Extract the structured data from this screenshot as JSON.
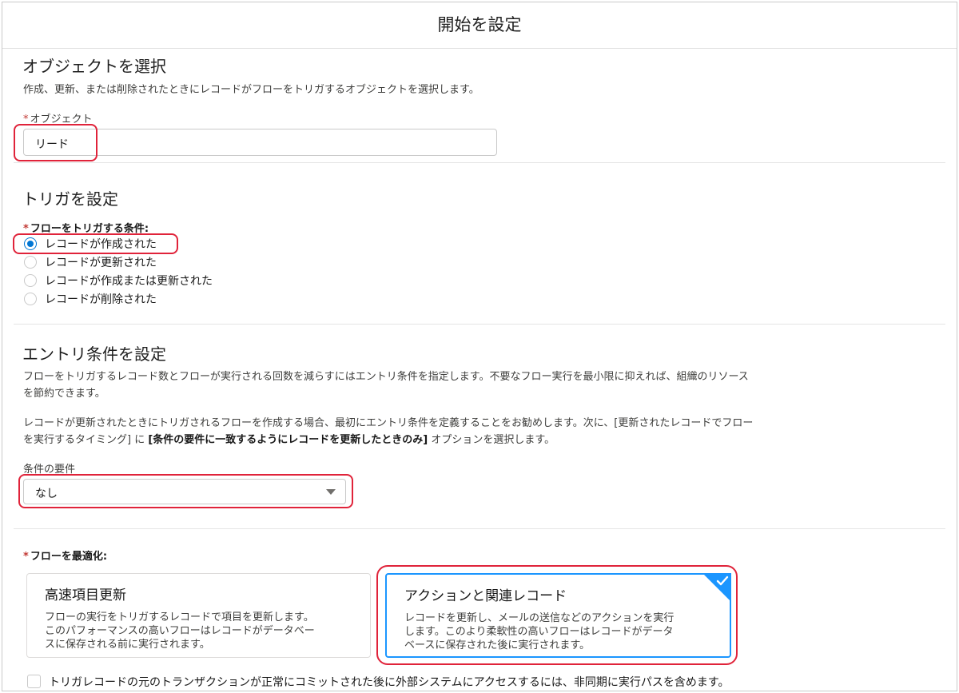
{
  "header": {
    "title": "開始を設定"
  },
  "object_section": {
    "title": "オブジェクトを選択",
    "description": "作成、更新、または削除されたときにレコードがフローをトリガするオブジェクトを選択します。",
    "field_required": "*",
    "field_label": "オブジェクト",
    "field_value": "リード"
  },
  "trigger_section": {
    "title": "トリガを設定",
    "label_required": "*",
    "label": "フローをトリガする条件:",
    "options": [
      {
        "label": "レコードが作成された",
        "selected": true
      },
      {
        "label": "レコードが更新された",
        "selected": false
      },
      {
        "label": "レコードが作成または更新された",
        "selected": false
      },
      {
        "label": "レコードが削除された",
        "selected": false
      }
    ]
  },
  "entry_section": {
    "title": "エントリ条件を設定",
    "desc1_line1": "フローをトリガするレコード数とフローが実行される回数を減らすにはエントリ条件を指定します。不要なフロー実行を最小限に抑えれば、組織のリソース",
    "desc1_line2": "を節約できます。",
    "desc2_line1": "レコードが更新されたときにトリガされるフローを作成する場合、最初にエントリ条件を定義することをお勧めします。次に、[更新されたレコードでフロー",
    "desc2_line2_a": "を実行するタイミング] に ",
    "desc2_line2_bold": "[条件の要件に一致するようにレコードを更新したときのみ]",
    "desc2_line2_c": " オプションを選択します。",
    "select_label": "条件の要件",
    "select_value": "なし"
  },
  "optimize_section": {
    "label_required": "*",
    "label": "フローを最適化:",
    "cards": [
      {
        "title": "高速項目更新",
        "desc_line1": "フローの実行をトリガするレコードで項目を更新します。",
        "desc_line2": "このパフォーマンスの高いフローはレコードがデータベー",
        "desc_line3": "スに保存される前に実行されます。",
        "selected": false
      },
      {
        "title": "アクションと関連レコード",
        "desc_line1": "レコードを更新し、メールの送信などのアクションを実行",
        "desc_line2": "します。このより柔軟性の高いフローはレコードがデータ",
        "desc_line3": "ベースに保存された後に実行されます。",
        "selected": true
      }
    ],
    "async_checkbox_label": "トリガレコードの元のトランザクションが正常にコミットされた後に外部システムにアクセスするには、非同期に実行パスを含めます。"
  },
  "colors": {
    "accent": "#1b96ff",
    "highlight": "#e0233a",
    "required": "#c23934",
    "radio": "#0176d3"
  },
  "icons": [
    "radio-selected-icon",
    "chevron-down-icon",
    "checkmark-icon"
  ]
}
